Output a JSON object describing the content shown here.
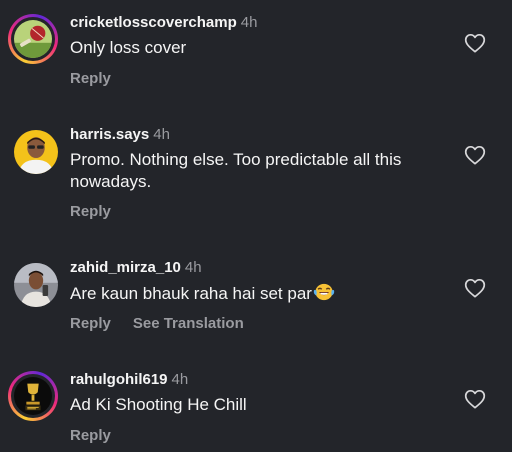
{
  "comments": [
    {
      "username": "cricketlosscoverchamp",
      "time": "4h",
      "text": "Only loss cover",
      "reply_label": "Reply",
      "avatar_icon": "cricket-ball-avatar"
    },
    {
      "username": "harris.says",
      "time": "4h",
      "text": "Promo. Nothing else. Too predictable all this nowadays.",
      "reply_label": "Reply",
      "avatar_icon": "person-avatar"
    },
    {
      "username": "zahid_mirza_10",
      "time": "4h",
      "text": "Are kaun bhauk raha hai set par",
      "emoji_icon": "laughing-crying-emoji",
      "reply_label": "Reply",
      "translation_label": "See Translation",
      "avatar_icon": "person-avatar"
    },
    {
      "username": "rahulgohil619",
      "time": "4h",
      "text": "Ad Ki Shooting He Chill",
      "reply_label": "Reply",
      "avatar_icon": "trophy-avatar"
    }
  ],
  "colors": {
    "background": "#23252a",
    "primary_text": "#f5f5f5",
    "secondary_text": "#9a9ba0"
  },
  "icons": {
    "like": "heart-outline-icon"
  }
}
